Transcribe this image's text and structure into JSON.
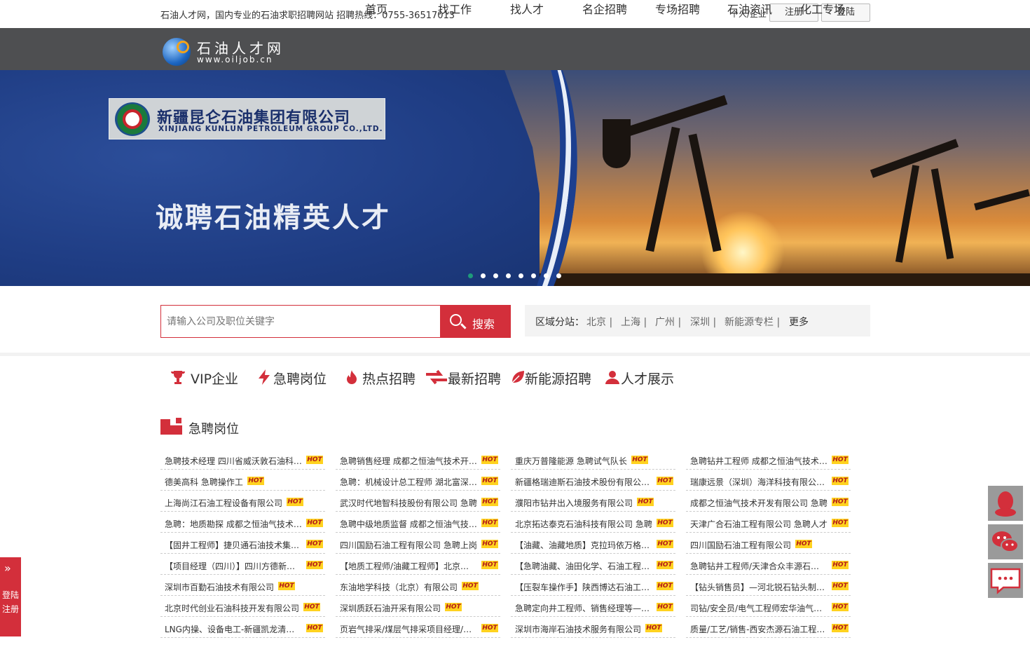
{
  "topbar": {
    "slogan": "石油人才网，国内专业的石油求职招聘网站 招聘热线：0755-36517013",
    "role_switch": "个人/企业",
    "register_label": "注册",
    "login_label": "登陆"
  },
  "logo": {
    "cn": "石油人才网",
    "en": "www.oiljob.cn"
  },
  "nav": {
    "items": [
      {
        "label": "首页",
        "active": true
      },
      {
        "label": "找工作"
      },
      {
        "label": "找人才"
      },
      {
        "label": "名企招聘"
      },
      {
        "label": "专场招聘"
      },
      {
        "label": "石油资讯"
      },
      {
        "label": "化工专场"
      }
    ]
  },
  "banner": {
    "company_cn": "新疆昆仑石油集团有限公司",
    "company_en": "XINJIANG KUNLUN PETROLEUM GROUP CO.,LTD.",
    "headline": "诚聘石油精英人才",
    "slides": 8,
    "active_slide": 1
  },
  "search": {
    "placeholder": "请输入公司及职位关键字",
    "button_label": "搜索"
  },
  "region": {
    "label": "区域分站：",
    "links": [
      "北京 |",
      "上海 |",
      "广州 |",
      "深圳 |",
      "新能源专栏 |"
    ],
    "more": "更多"
  },
  "tabs": [
    {
      "label": "VIP企业",
      "icon": "trophy-icon"
    },
    {
      "label": "急聘岗位",
      "icon": "lightning-icon"
    },
    {
      "label": "热点招聘",
      "icon": "flame-icon"
    },
    {
      "label": "最新招聘",
      "icon": "refresh-icon"
    },
    {
      "label": "新能源招聘",
      "icon": "leaf-icon"
    },
    {
      "label": "人才展示",
      "icon": "user-icon"
    }
  ],
  "section": {
    "title": "急聘岗位",
    "hot_badge": "HOT"
  },
  "jobs": [
    [
      "急聘技术经理 四川省威沃敦石油科技股份有限公司",
      "德美高科 急聘操作工",
      "上海尚江石油工程设备有限公司",
      "急聘：地质勘探 成都之恒油气技术开发有限公司",
      "【固井工程师】捷贝通石油技术集团股份有限公司",
      "【项目经理（四川）】四川方德新能源有限公司",
      "深圳市百勤石油技术有限公司",
      "北京时代创业石油科技开发有限公司",
      "LNG内操、设备电工-新疆凯龙清洁能源股份有限公司"
    ],
    [
      "急聘销售经理 成都之恒油气技术开发有限公司",
      "急聘：机械设计总工程师 湖北富深石油装备有限公司",
      "武汉时代地智科技股份有限公司 急聘",
      "急聘中级地质监督 成都之恒油气技术开发有限公司",
      "四川国励石油工程有限公司 急聘上岗",
      "【地质工程师/油藏工程师】北京石油科技有限公司",
      "东油地学科技（北京）有限公司",
      "深圳质跃石油开采有限公司",
      "页岩气排采/煤层气排采项目经理/重庆公司"
    ],
    [
      "重庆万普隆能源 急聘试气队长",
      "新疆格瑞迪斯石油技术股份有限公司急聘",
      "濮阳市钻井出入境服务有限公司",
      "北京拓达泰克石油科技有限公司 急聘",
      "【油藏、油藏地质】克拉玛依万格迪能源",
      "【急聘油藏、油田化学、石油工程等专业人才】",
      "【压裂车操作手】陕西博达石油工程有限公司",
      "急聘定向井工程师、销售经理等—奥瑞拓公司",
      "深圳市海岸石油技术服务有限公司"
    ],
    [
      "急聘钻井工程师 成都之恒油气技术开发有限公司",
      "瑞康远景（深圳）海洋科技有限公司急聘",
      "成都之恒油气技术开发有限公司 急聘",
      "天津广合石油工程有限公司 急聘人才",
      "四川国励石油工程有限公司",
      "急聘钻井工程师/天津合众丰源石油技术",
      "【钻头销售员】—河北锐石钻头制造有限公司",
      "司钻/安全员/电气工程师宏华油气工程",
      "质量/工艺/销售-西安杰源石油工程有限公司"
    ]
  ],
  "side": {
    "login_register": "登陆注册",
    "qq": "qq-penguin-icon",
    "wechat": "wechat-icon",
    "message": "message-icon"
  },
  "colors": {
    "accent": "#d32f3b",
    "nav_bg": "#4e4f51",
    "hot_badge": "#ffd21f"
  }
}
